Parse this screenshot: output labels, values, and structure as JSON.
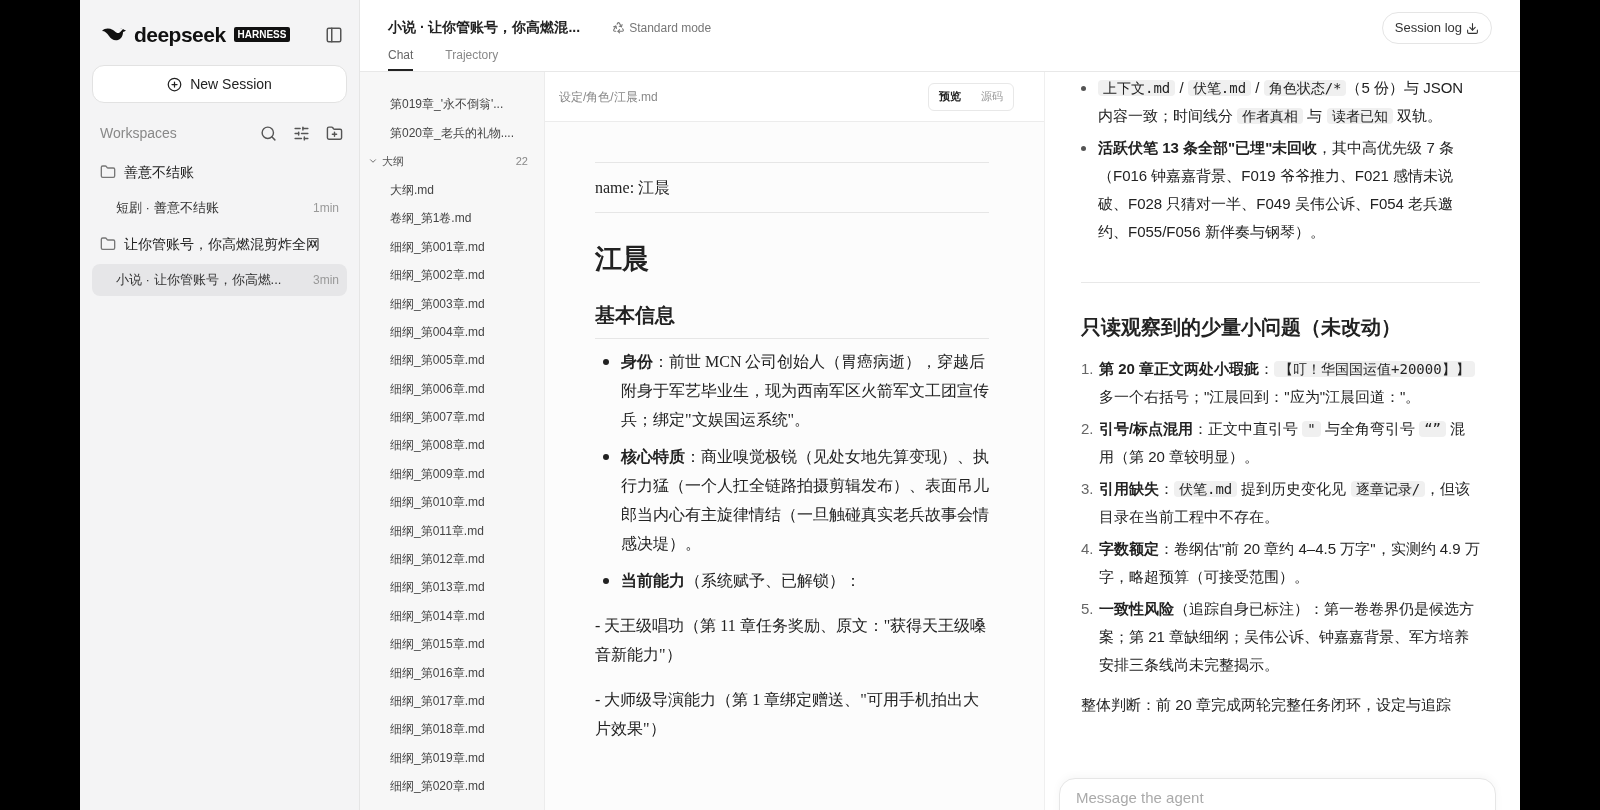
{
  "sidebar": {
    "logo_text": "deepseek",
    "logo_badge": "HARNESS",
    "new_session": "New Session",
    "workspaces_label": "Workspaces",
    "workspaces": [
      {
        "kind": "folder",
        "label": "善意不结账",
        "selected": false
      },
      {
        "kind": "session",
        "label": "短剧 · 善意不结账",
        "time": "1min",
        "selected": false
      },
      {
        "kind": "folder",
        "label": "让你管账号，你高燃混剪炸全网",
        "selected": false
      },
      {
        "kind": "session",
        "label": "小说 · 让你管账号，你高燃...",
        "time": "3min",
        "selected": true
      }
    ]
  },
  "header": {
    "title": "小说 · 让你管账号，你高燃混...",
    "mode": "Standard mode",
    "session_log": "Session log",
    "tabs": [
      {
        "label": "Chat",
        "selected": true
      },
      {
        "label": "Trajectory",
        "selected": false
      }
    ]
  },
  "file_tree": [
    {
      "kind": "file",
      "label": "第019章_'永不倒翁'..."
    },
    {
      "kind": "file",
      "label": "第020章_老兵的礼物...."
    },
    {
      "kind": "folder",
      "label": "大纲",
      "count": "22",
      "expanded": true,
      "children": [
        {
          "kind": "file",
          "label": "大纲.md"
        },
        {
          "kind": "file",
          "label": "卷纲_第1卷.md"
        },
        {
          "kind": "file",
          "label": "细纲_第001章.md"
        },
        {
          "kind": "file",
          "label": "细纲_第002章.md"
        },
        {
          "kind": "file",
          "label": "细纲_第003章.md"
        },
        {
          "kind": "file",
          "label": "细纲_第004章.md"
        },
        {
          "kind": "file",
          "label": "细纲_第005章.md"
        },
        {
          "kind": "file",
          "label": "细纲_第006章.md"
        },
        {
          "kind": "file",
          "label": "细纲_第007章.md"
        },
        {
          "kind": "file",
          "label": "细纲_第008章.md"
        },
        {
          "kind": "file",
          "label": "细纲_第009章.md"
        },
        {
          "kind": "file",
          "label": "细纲_第010章.md"
        },
        {
          "kind": "file",
          "label": "细纲_第011章.md"
        },
        {
          "kind": "file",
          "label": "细纲_第012章.md"
        },
        {
          "kind": "file",
          "label": "细纲_第013章.md"
        },
        {
          "kind": "file",
          "label": "细纲_第014章.md"
        },
        {
          "kind": "file",
          "label": "细纲_第015章.md"
        },
        {
          "kind": "file",
          "label": "细纲_第016章.md"
        },
        {
          "kind": "file",
          "label": "细纲_第017章.md"
        },
        {
          "kind": "file",
          "label": "细纲_第018章.md"
        },
        {
          "kind": "file",
          "label": "细纲_第019章.md"
        },
        {
          "kind": "file",
          "label": "细纲_第020章.md"
        }
      ]
    }
  ],
  "document": {
    "path": "设定/角色/江晨.md",
    "view_toggle": [
      {
        "label": "预览",
        "selected": true
      },
      {
        "label": "源码",
        "selected": false
      }
    ],
    "blocks": [
      {
        "kind": "rule"
      },
      {
        "kind": "para",
        "text": "name: 江晨"
      },
      {
        "kind": "rule"
      },
      {
        "kind": "h1",
        "text": "江晨"
      },
      {
        "kind": "h2",
        "text": "基本信息"
      },
      {
        "kind": "bullet",
        "text": "**身份**：前世 MCN 公司创始人（胃癌病逝），穿越后附身于军艺毕业生，现为西南军区火箭军文工团宣传兵；绑定\"文娱国运系统\"。"
      },
      {
        "kind": "bullet",
        "text": "**核心特质**：商业嗅觉极锐（见处女地先算变现）、执行力猛（一个人扛全链路拍摄剪辑发布）、表面吊儿郎当内心有主旋律情结（一旦触碰真实老兵故事会情感决堤）。"
      },
      {
        "kind": "bullet",
        "text": "**当前能力**（系统赋予、已解锁）："
      },
      {
        "kind": "para",
        "text": "- 天王级唱功（第 11 章任务奖励、原文：\"获得天王级嗓音新能力\"）"
      },
      {
        "kind": "para",
        "text": "- 大师级导演能力（第 1 章绑定赠送、\"可用手机拍出大片效果\"）"
      }
    ]
  },
  "chat": {
    "blocks": [
      {
        "kind": "bullet",
        "segments": [
          {
            "kind": "code",
            "text": "上下文.md"
          },
          {
            "kind": "text",
            "text": " / "
          },
          {
            "kind": "code",
            "text": "伏笔.md"
          },
          {
            "kind": "text",
            "text": " / "
          },
          {
            "kind": "code",
            "text": "角色状态/*"
          },
          {
            "kind": "text",
            "text": "（5 份）与 JSON 内容一致；时间线分 "
          },
          {
            "kind": "code",
            "text": "作者真相"
          },
          {
            "kind": "text",
            "text": " 与 "
          },
          {
            "kind": "code",
            "text": "读者已知"
          },
          {
            "kind": "text",
            "text": " 双轨。"
          }
        ]
      },
      {
        "kind": "bullet",
        "segments": [
          {
            "kind": "bold",
            "text": "活跃伏笔 13 条全部\"已埋\"未回收"
          },
          {
            "kind": "text",
            "text": "，其中高优先级 7 条（F016 钟嘉嘉背景、F019 爷爷推力、F021 感情未说破、F028 只猜对一半、F049 吴伟公诉、F054 老兵邀约、F055/F056 新伴奏与钢琴）。"
          }
        ]
      },
      {
        "kind": "rule"
      },
      {
        "kind": "heading",
        "segments": [
          {
            "kind": "text",
            "text": "只读观察到的少量小问题（未改动）"
          }
        ]
      },
      {
        "kind": "numbered",
        "number": "1.",
        "segments": [
          {
            "kind": "bold",
            "text": "第 20 章正文两处小瑕疵"
          },
          {
            "kind": "text",
            "text": "："
          },
          {
            "kind": "code",
            "text": "【叮！华国国运值+20000】】"
          },
          {
            "kind": "text",
            "text": " 多一个右括号；\"江晨回到：\"应为\"江晨回道：\"。"
          }
        ]
      },
      {
        "kind": "numbered",
        "number": "2.",
        "segments": [
          {
            "kind": "bold",
            "text": "引号/标点混用"
          },
          {
            "kind": "text",
            "text": "：正文中直引号 "
          },
          {
            "kind": "code",
            "text": "\""
          },
          {
            "kind": "text",
            "text": " 与全角弯引号 "
          },
          {
            "kind": "code",
            "text": "“”"
          },
          {
            "kind": "text",
            "text": " 混用（第 20 章较明显）。"
          }
        ]
      },
      {
        "kind": "numbered",
        "number": "3.",
        "segments": [
          {
            "kind": "bold",
            "text": "引用缺失"
          },
          {
            "kind": "text",
            "text": "："
          },
          {
            "kind": "code",
            "text": "伏笔.md"
          },
          {
            "kind": "text",
            "text": " 提到历史变化见 "
          },
          {
            "kind": "code",
            "text": "逐章记录/"
          },
          {
            "kind": "text",
            "text": "，但该目录在当前工程中不存在。"
          }
        ]
      },
      {
        "kind": "numbered",
        "number": "4.",
        "segments": [
          {
            "kind": "bold",
            "text": "字数额定"
          },
          {
            "kind": "text",
            "text": "：卷纲估\"前 20 章约 4–4.5 万字\"，实测约 4.9 万字，略超预算（可接受范围）。"
          }
        ]
      },
      {
        "kind": "numbered",
        "number": "5.",
        "segments": [
          {
            "kind": "bold",
            "text": "一致性风险"
          },
          {
            "kind": "text",
            "text": "（追踪自身已标注）：第一卷卷界仍是候选方案；第 21 章缺细纲；吴伟公诉、钟嘉嘉背景、军方培养安排三条线尚未完整揭示。"
          }
        ]
      },
      {
        "kind": "para",
        "segments": [
          {
            "kind": "text",
            "text": "整体判断：前 20 章完成两轮完整任务闭环，设定与追踪"
          }
        ]
      }
    ],
    "input": {
      "placeholder": "Message the agent"
    }
  }
}
